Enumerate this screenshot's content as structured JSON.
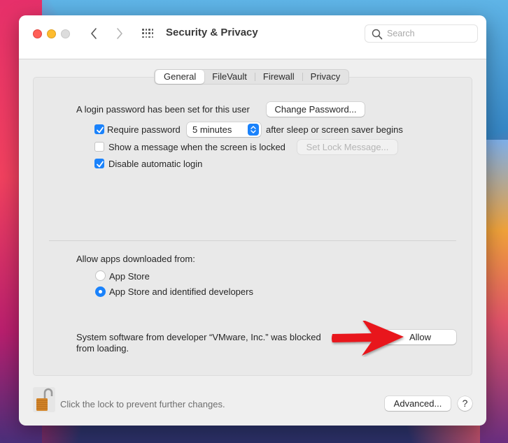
{
  "window": {
    "title": "Security & Privacy",
    "search_placeholder": "Search",
    "nav": {
      "back": "‹",
      "forward": "›"
    }
  },
  "tabs": [
    {
      "label": "General",
      "active": true
    },
    {
      "label": "FileVault",
      "active": false
    },
    {
      "label": "Firewall",
      "active": false
    },
    {
      "label": "Privacy",
      "active": false
    }
  ],
  "general": {
    "login_password_text": "A login password has been set for this user",
    "change_password_label": "Change Password...",
    "require_password": {
      "label": "Require password",
      "checked": true,
      "delay_value": "5 minutes",
      "suffix": "after sleep or screen saver begins"
    },
    "show_message": {
      "label": "Show a message when the screen is locked",
      "checked": false,
      "button_label": "Set Lock Message..."
    },
    "disable_auto_login": {
      "label": "Disable automatic login",
      "checked": true
    },
    "allow_apps": {
      "heading": "Allow apps downloaded from:",
      "options": [
        {
          "label": "App Store",
          "selected": false
        },
        {
          "label": "App Store and identified developers",
          "selected": true
        }
      ]
    },
    "blocked_software": {
      "line1": "System software from developer “VMware, Inc.” was blocked",
      "line2": "from loading.",
      "allow_label": "Allow"
    }
  },
  "footer": {
    "lock_text": "Click the lock to prevent further changes.",
    "advanced_label": "Advanced...",
    "help_label": "?"
  },
  "annotation": {
    "arrow_color": "#e8141b"
  },
  "colors": {
    "accent": "#1a82fb"
  }
}
